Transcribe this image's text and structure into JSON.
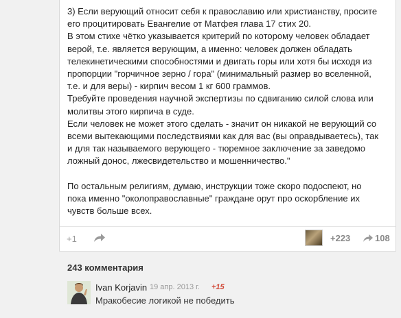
{
  "post": {
    "paragraphs": [
      [
        "3) Если верующий относит себя к православию или христианству, просите",
        "его процитировать Евангелие от Матфея глава 17 стих 20."
      ],
      [
        "В этом стихе чётко указывается критерий по которому человек обладает",
        "верой, т.е. является верующим, а именно: человек должен обладать",
        "телекинетическими способностями и двигать горы или хотя бы исходя из",
        "пропорции \"горчичное зерно / гора\" (минимальный размер во вселенной,",
        "т.е. и для веры) - кирпич весом 1 кг 600 граммов."
      ],
      [
        "Требуйте проведения научной экспертизы по сдвиганию силой слова или",
        "молитвы этого кирпича в суде."
      ],
      [
        "Если человек не может этого сделать - значит он никакой не верующий со",
        "всеми вытекающими последствиями как для вас (вы оправдываетесь), так",
        "и для так называемого верующего - тюремное заключение за заведомо",
        "ложный донос, лжесвидетельство и мошенничество.\""
      ],
      [
        "По остальным религиям, думаю, инструкции тоже скоро подоспеют, но",
        "пока именно \"околоправославные\" граждане орут про оскорбление их",
        "чувств больше всех."
      ]
    ]
  },
  "actions": {
    "plus_one": "+1",
    "plus_count": "+223",
    "reshare_count": "108"
  },
  "comments": {
    "title": "243 комментария",
    "items": [
      {
        "author": "Ivan Korjavin",
        "date": "19 апр. 2013 г.",
        "plus": "+15",
        "text": "Мракобесие логикой не победить"
      }
    ]
  }
}
